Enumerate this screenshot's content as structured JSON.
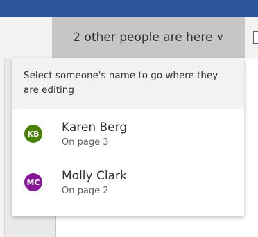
{
  "presence": {
    "button_label": "2 other people are here",
    "chevron": "∨"
  },
  "dropdown": {
    "header": "Select someone's name to go where they are editing",
    "people": [
      {
        "initials": "KB",
        "name": "Karen Berg",
        "status": "On page 3",
        "color": "#498205"
      },
      {
        "initials": "MC",
        "name": "Molly Clark",
        "status": "On page 2",
        "color": "#881798"
      }
    ]
  },
  "colors": {
    "title_bar": "#2b579a",
    "ribbon": "#f3f2f1",
    "button_active": "#c8c6c4"
  },
  "icons": [
    "chevron-down-icon",
    "comment-icon",
    "screen-icon"
  ]
}
